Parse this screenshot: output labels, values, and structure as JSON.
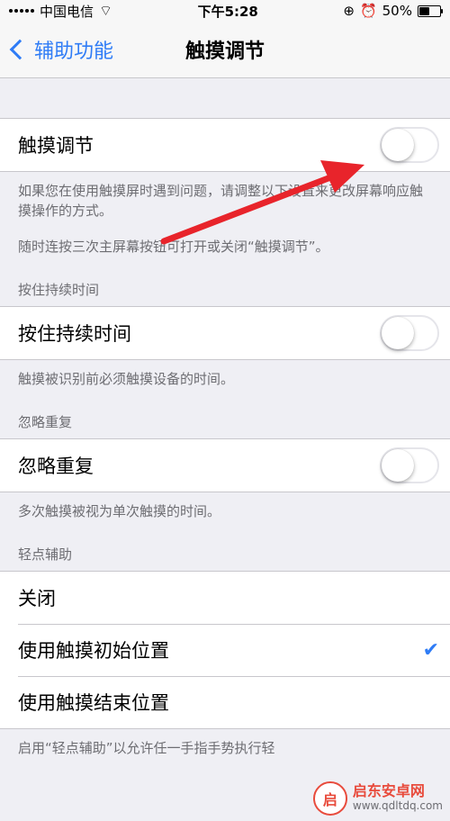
{
  "status_bar": {
    "carrier": "中国电信",
    "time": "下午5:28",
    "battery": "50%",
    "battery_level": 0.5
  },
  "nav": {
    "back_label": "辅助功能",
    "title": "触摸调节"
  },
  "touch_accommodations": {
    "label": "触摸调节",
    "enabled": false,
    "footer_1": "如果您在使用触摸屏时遇到问题，请调整以下设置来更改屏幕响应触摸操作的方式。",
    "footer_2": "随时连按三次主屏幕按钮可打开或关闭“触摸调节”。"
  },
  "hold_duration": {
    "header": "按住持续时间",
    "label": "按住持续时间",
    "enabled": false,
    "footer": "触摸被识别前必须触摸设备的时间。"
  },
  "ignore_repeat": {
    "header": "忽略重复",
    "label": "忽略重复",
    "enabled": false,
    "footer": "多次触摸被视为单次触摸的时间。"
  },
  "tap_assistance": {
    "header": "轻点辅助",
    "options": [
      {
        "label": "关闭",
        "selected": false
      },
      {
        "label": "使用触摸初始位置",
        "selected": true
      },
      {
        "label": "使用触摸结束位置",
        "selected": false
      }
    ],
    "footer": "启用“轻点辅助”以允许任一手指手势执行轻"
  },
  "watermark": {
    "logo_text": "启",
    "title": "启东安卓网",
    "url": "www.qdltdq.com"
  },
  "colors": {
    "accent": "#2f7cf6",
    "background": "#efeff4",
    "annotation_arrow": "#e8242b"
  }
}
